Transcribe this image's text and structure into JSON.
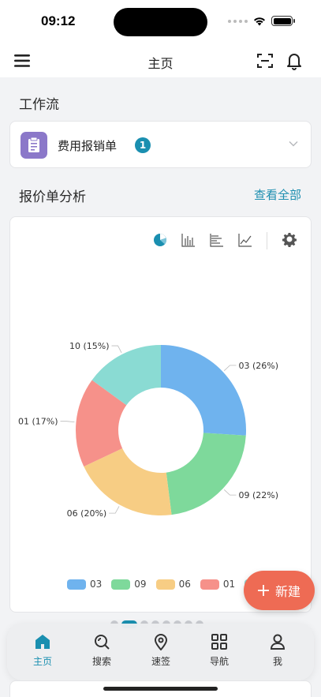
{
  "status": {
    "time": "09:12"
  },
  "nav": {
    "title": "主页"
  },
  "workflow": {
    "section_title": "工作流",
    "item_label": "费用报销单",
    "badge": "1"
  },
  "analysis": {
    "section_title": "报价单分析",
    "view_all": "查看全部"
  },
  "chart_data": {
    "type": "pie",
    "donut": true,
    "categories": [
      "03",
      "09",
      "06",
      "01",
      "10"
    ],
    "values": [
      26,
      22,
      20,
      17,
      15
    ],
    "labels": [
      "03 (26%)",
      "09 (22%)",
      "06 (20%)",
      "01 (17%)",
      "10 (15%)"
    ],
    "colors": [
      "#6fb3ee",
      "#7ed99b",
      "#f7cd84",
      "#f6918a",
      "#8adbd3"
    ],
    "legend_placement": "bottom"
  },
  "new_button": {
    "label": "新建"
  },
  "tabs": [
    {
      "label": "主页",
      "icon": "home-icon",
      "active": true
    },
    {
      "label": "搜索",
      "icon": "search-icon",
      "active": false
    },
    {
      "label": "速签",
      "icon": "location-pin-icon",
      "active": false
    },
    {
      "label": "导航",
      "icon": "grid-icon",
      "active": false
    },
    {
      "label": "我",
      "icon": "user-icon",
      "active": false
    }
  ],
  "colors": {
    "accent": "#1a8fb0",
    "fab": "#ee6b54",
    "workflow_icon_bg": "#8b78c9"
  }
}
